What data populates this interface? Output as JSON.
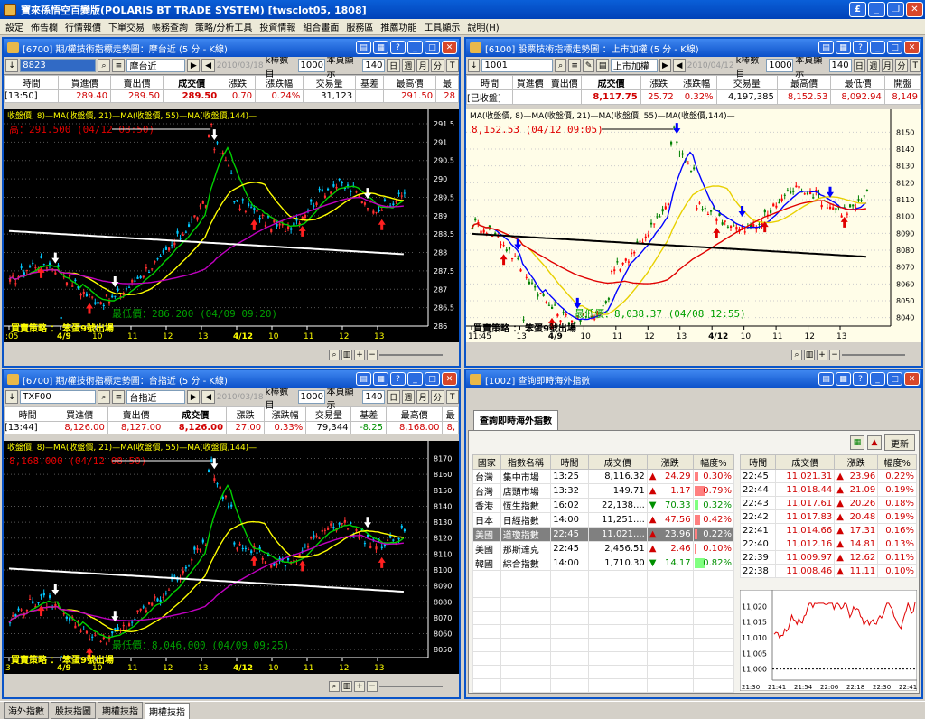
{
  "app": {
    "title": "寶來孫悟空百變版(POLARIS BT TRADE SYSTEM)   [twsclot05, 1808]"
  },
  "menu": [
    "設定",
    "佈告欄",
    "行情報價",
    "下單交易",
    "帳務查詢",
    "策略/分析工具",
    "投資情報",
    "組合畫面",
    "服務區",
    "推薦功能",
    "工具顯示",
    "說明(H)"
  ],
  "colors": {
    "up": "#d00000",
    "down": "#009000",
    "chartbg_dark": "#000000",
    "chartbg_light": "#fffde8",
    "ma8": "#00d000",
    "ma21": "#ffff00",
    "ma55": "#c000c0",
    "ma144": "#ffffff"
  },
  "panels": [
    {
      "title": "[6700] 期/權技術指標走勢圖：摩台近 (5 分 - K線)",
      "code": "8823",
      "name": "摩台近",
      "date": "2010/03/18",
      "kcount_label": "k棒數目",
      "kcount": "1000",
      "show_label": "本頁顯示",
      "show": "140",
      "period": [
        "日",
        "週",
        "月",
        "分",
        "T"
      ],
      "headers": [
        "時間",
        "買進價",
        "賣出價",
        "成交價",
        "漲跌",
        "漲跌幅",
        "交易量",
        "基差",
        "最高價",
        "最"
      ],
      "row": [
        "[13:50]",
        "289.40",
        "289.50",
        "289.50",
        "0.70",
        "0.24%",
        "31,123",
        "",
        "291.50",
        "28"
      ],
      "legend": "收盤價, 8)—MA(收盤價, 21)—MA(收盤價, 55)—MA(收盤價,144)—",
      "high_label": "高：291.500 (04/12 08:50)",
      "low_label": "最低價：286.200 (04/09 09:20)",
      "strategy": "買賣策略 ： 笨蛋9號出場",
      "yticks": [
        "291.5",
        "291",
        "290.5",
        "290",
        "289.5",
        "289",
        "288.5",
        "288",
        "287.5",
        "287",
        "286.5",
        "286"
      ],
      "xticks": [
        ":05",
        "4/9",
        "10",
        "11",
        "12",
        "13",
        "4/12",
        "10",
        "11",
        "12",
        "13"
      ],
      "chart_data": {
        "type": "candlestick",
        "y_range": [
          286,
          291.5
        ],
        "high": 291.5,
        "low": 286.2,
        "series": [
          {
            "name": "MA(收盤價, 8)"
          },
          {
            "name": "MA(收盤價, 21)"
          },
          {
            "name": "MA(收盤價, 55)"
          },
          {
            "name": "MA(收盤價,144)"
          }
        ]
      }
    },
    {
      "title": "[6100] 股票技術指標走勢圖 ：上市加權 (5 分 - K線)",
      "code": "1001",
      "name": "上市加權",
      "date": "2010/04/12",
      "kcount_label": "k棒數目",
      "kcount": "1000",
      "show_label": "本頁顯示",
      "show": "140",
      "period": [
        "日",
        "週",
        "月",
        "分",
        "T"
      ],
      "headers": [
        "時間",
        "買進價",
        "賣出價",
        "成交價",
        "漲跌",
        "漲跌幅",
        "交易量",
        "最高價",
        "最低價",
        "開盤"
      ],
      "row": [
        "[已收盤]",
        "",
        "",
        "8,117.75",
        "25.72",
        "0.32%",
        "4,197,385",
        "8,152.53",
        "8,092.94",
        "8,149"
      ],
      "legend": "MA(收盤價, 8)—MA(收盤價, 21)—MA(收盤價, 55)—MA(收盤價,144)—",
      "high_label": "8,152.53 (04/12 09:05)",
      "low_label": "最低價：8,038.37 (04/08 12:55)",
      "strategy": "買賣策略 ： 笨蛋9號出場",
      "yticks": [
        "8150",
        "8140",
        "8130",
        "8120",
        "8110",
        "8100",
        "8090",
        "8080",
        "8070",
        "8060",
        "8050",
        "8040"
      ],
      "xticks": [
        "11:45",
        "13",
        "4/9",
        "10",
        "11",
        "12",
        "13",
        "4/12",
        "10",
        "11",
        "12",
        "13"
      ],
      "chart_data": {
        "type": "candlestick",
        "y_range": [
          8035,
          8155
        ],
        "high": 8152.53,
        "low": 8038.37,
        "series": [
          {
            "name": "MA(收盤價, 8)"
          },
          {
            "name": "MA(收盤價, 21)"
          },
          {
            "name": "MA(收盤價, 55)"
          },
          {
            "name": "MA(收盤價,144)"
          }
        ]
      }
    },
    {
      "title": "[6700] 期/權技術指標走勢圖：台指近 (5 分 - K線)",
      "code": "TXF00",
      "name": "台指近",
      "date": "2010/03/18",
      "kcount_label": "k棒數目",
      "kcount": "1000",
      "show_label": "本頁顯示",
      "show": "140",
      "period": [
        "日",
        "週",
        "月",
        "分",
        "T"
      ],
      "headers": [
        "時間",
        "買進價",
        "賣出價",
        "成交價",
        "漲跌",
        "漲跌幅",
        "交易量",
        "基差",
        "最高價",
        "最"
      ],
      "row": [
        "[13:44]",
        "8,126.00",
        "8,127.00",
        "8,126.00",
        "27.00",
        "0.33%",
        "79,344",
        "-8.25",
        "8,168.00",
        "8,"
      ],
      "legend": "收盤價, 8)—MA(收盤價, 21)—MA(收盤價, 55)—MA(收盤價,144)—",
      "high_label": "8,168.000 (04/12 08:50)",
      "low_label": "最低價：8,046.000 (04/09 09:25)",
      "strategy": "買賣策略 ： 笨蛋9號出場",
      "yticks": [
        "8170",
        "8160",
        "8150",
        "8140",
        "8130",
        "8120",
        "8110",
        "8100",
        "8090",
        "8080",
        "8070",
        "8060",
        "8050"
      ],
      "xticks": [
        "3",
        "4/9",
        "10",
        "11",
        "12",
        "13",
        "4/12",
        "10",
        "11",
        "12",
        "13"
      ],
      "chart_data": {
        "type": "candlestick",
        "y_range": [
          8045,
          8172
        ],
        "high": 8168,
        "low": 8046,
        "series": [
          {
            "name": "MA(收盤價, 8)"
          },
          {
            "name": "MA(收盤價, 21)"
          },
          {
            "name": "MA(收盤價, 55)"
          },
          {
            "name": "MA(收盤價,144)"
          }
        ]
      }
    }
  ],
  "intl": {
    "title": "[1002] 查詢即時海外指數",
    "tab": "查詢即時海外指數",
    "refresh": "更新",
    "headers": [
      "國家",
      "指數名稱",
      "時間",
      "成交價",
      "漲跌",
      "幅度%"
    ],
    "rows": [
      {
        "country": "台灣",
        "name": "集中市場",
        "time": "13:25",
        "price": "8,116.32",
        "dir": "up",
        "chg": "24.29",
        "pct": "0.30%"
      },
      {
        "country": "台灣",
        "name": "店頭市場",
        "time": "13:32",
        "price": "149.71",
        "dir": "up",
        "chg": "1.17",
        "pct": "0.79%"
      },
      {
        "country": "香港",
        "name": "恆生指數",
        "time": "16:02",
        "price": "22,138....",
        "dir": "dn",
        "chg": "70.33",
        "pct": "0.32%"
      },
      {
        "country": "日本",
        "name": "日經指數",
        "time": "14:00",
        "price": "11,251....",
        "dir": "up",
        "chg": "47.56",
        "pct": "0.42%"
      },
      {
        "country": "美國",
        "name": "道瓊指數",
        "time": "22:45",
        "price": "11,021....",
        "dir": "up",
        "chg": "23.96",
        "pct": "0.22%"
      },
      {
        "country": "美國",
        "name": "那斯達克",
        "time": "22:45",
        "price": "2,456.51",
        "dir": "up",
        "chg": "2.46",
        "pct": "0.10%"
      },
      {
        "country": "韓國",
        "name": "綜合指數",
        "time": "14:00",
        "price": "1,710.30",
        "dir": "dn",
        "chg": "14.17",
        "pct": "0.82%"
      }
    ],
    "tick_headers": [
      "時間",
      "成交價",
      "漲跌",
      "幅度%"
    ],
    "ticks": [
      [
        "22:45",
        "11,021.31",
        "23.96",
        "0.22%"
      ],
      [
        "22:44",
        "11,018.44",
        "21.09",
        "0.19%"
      ],
      [
        "22:43",
        "11,017.61",
        "20.26",
        "0.18%"
      ],
      [
        "22:42",
        "11,017.83",
        "20.48",
        "0.19%"
      ],
      [
        "22:41",
        "11,014.66",
        "17.31",
        "0.16%"
      ],
      [
        "22:40",
        "11,012.16",
        "14.81",
        "0.13%"
      ],
      [
        "22:39",
        "11,009.97",
        "12.62",
        "0.11%"
      ],
      [
        "22:38",
        "11,008.46",
        "11.11",
        "0.10%"
      ]
    ],
    "mini_chart": {
      "type": "line",
      "yticks": [
        "11,020",
        "11,015",
        "11,010",
        "11,005",
        "11,000"
      ],
      "xticks": [
        "21:30",
        "21:41",
        "21:54",
        "22:06",
        "22:18",
        "22:30",
        "22:41"
      ],
      "y_range": [
        10997,
        11023
      ]
    }
  },
  "bottom_tabs": [
    "海外指數",
    "股技指圖",
    "期權技指",
    "期權技指"
  ]
}
